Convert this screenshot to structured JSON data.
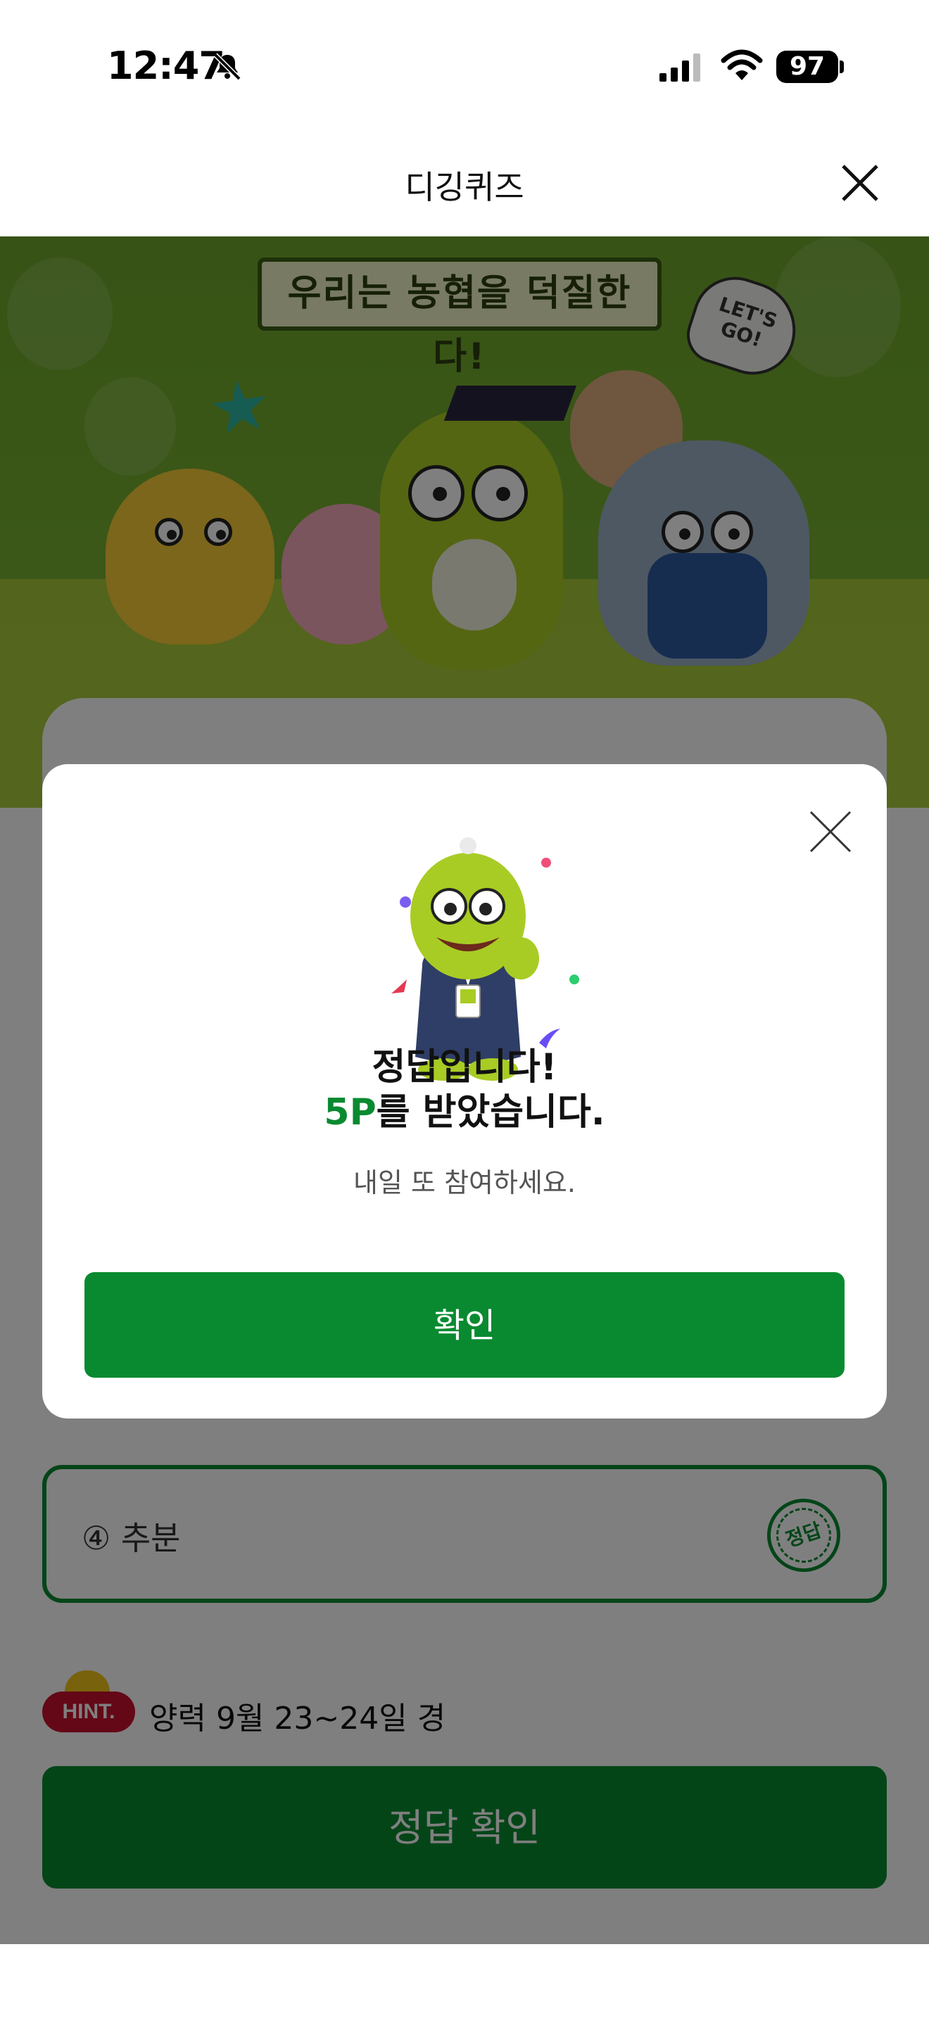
{
  "status_bar": {
    "time": "12:47",
    "battery": "97",
    "icons": [
      "bell-slash-icon",
      "cellular-signal-icon",
      "wifi-icon"
    ]
  },
  "header": {
    "title": "디깅퀴즈",
    "close_icon": "close-icon"
  },
  "banner": {
    "slogan": "우리는 농협을 덕질한다!",
    "speech_bubble": "LET'S GO!"
  },
  "quiz": {
    "answer_option": {
      "label": "④ 추분",
      "stamp": "정답"
    },
    "hint": {
      "badge": "HINT.",
      "text": "양력 9월 23~24일 경"
    },
    "submit_label": "정답 확인"
  },
  "modal": {
    "title": "정답입니다!",
    "points_value": "5P",
    "points_suffix": "를 받았습니다.",
    "subtitle": "내일 또 참여하세요.",
    "confirm_label": "확인"
  },
  "colors": {
    "brand_green": "#098a30",
    "hint_red": "#c8102e",
    "dimmer": "rgba(0,0,0,0.5)"
  }
}
